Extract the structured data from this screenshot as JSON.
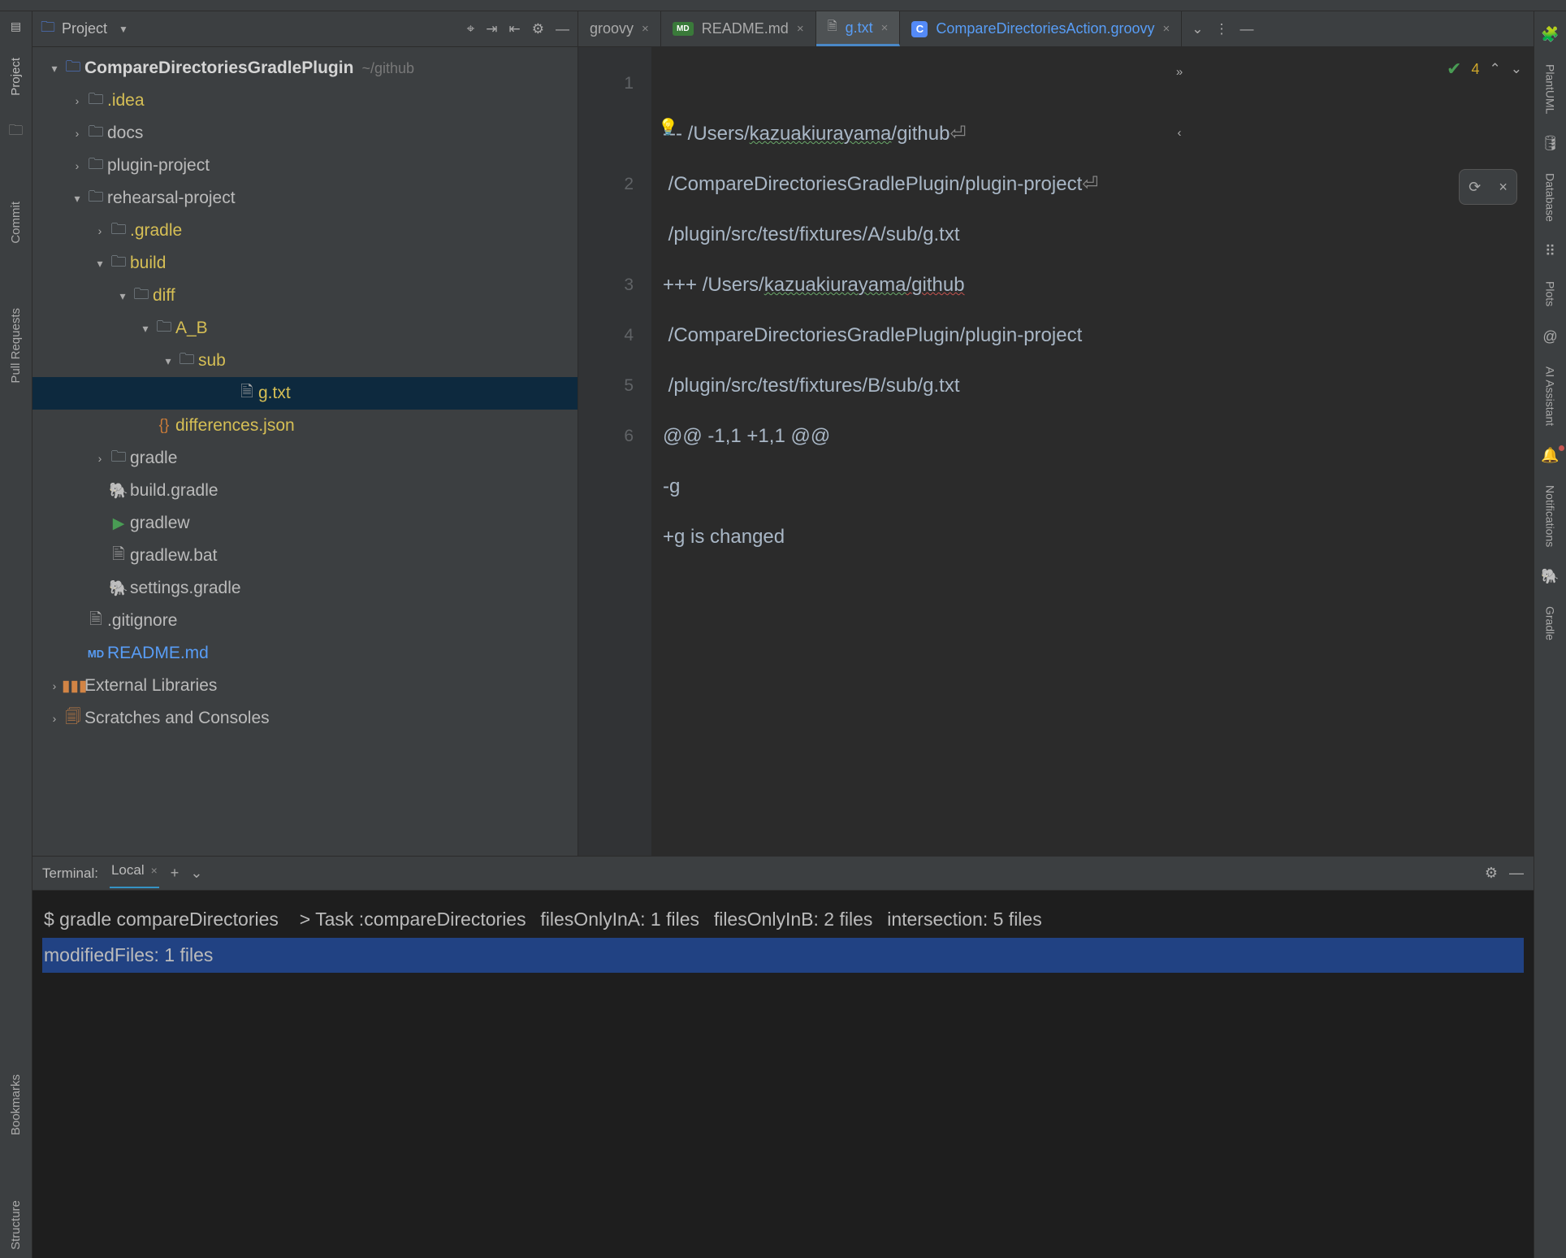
{
  "left_strip": {
    "items": [
      "Project",
      "Commit",
      "Pull Requests"
    ],
    "bottom": [
      "Bookmarks",
      "Structure"
    ]
  },
  "right_strip": {
    "items": [
      "PlantUML",
      "Database",
      "Plots",
      "AI Assistant",
      "Notifications",
      "Gradle"
    ]
  },
  "project_pane": {
    "title": "Project",
    "root": {
      "label": "CompareDirectoriesGradlePlugin",
      "path": "~/github"
    },
    "nodes": {
      "idea": ".idea",
      "docs": "docs",
      "plugin_project": "plugin-project",
      "rehearsal": "rehearsal-project",
      "gradle_hidden": ".gradle",
      "build": "build",
      "diff": "diff",
      "a_b": "A_B",
      "sub": "sub",
      "gtxt": "g.txt",
      "differences": "differences.json",
      "gradle_dir": "gradle",
      "build_gradle": "build.gradle",
      "gradlew": "gradlew",
      "gradlew_bat": "gradlew.bat",
      "settings_gradle": "settings.gradle",
      "gitignore": ".gitignore",
      "readme": "README.md",
      "ext_libs": "External Libraries",
      "scratches": "Scratches and Consoles"
    }
  },
  "tabs": {
    "t0": "groovy",
    "t1": "README.md",
    "t2": "g.txt",
    "t3": "CompareDirectoriesAction.groovy"
  },
  "hints": {
    "count": "4"
  },
  "editor": {
    "gutter": [
      "1",
      "2",
      "3",
      "4",
      "5",
      "6"
    ],
    "l1a": "--- /Users/",
    "l1b": "kazuakiurayama",
    "l1c": "/github",
    "l1d": " /CompareDirectoriesGradlePlugin/plugin-project",
    "l1e": " /plugin/src/test/fixtures/A/sub/g.txt",
    "l2a": "+++ /Users/",
    "l2b": "kazuakiurayama",
    "l2c": "/github",
    "l2d": " /CompareDirectoriesGradlePlugin/plugin-project",
    "l2e": " /plugin/src/test/fixtures/B/sub/g.txt",
    "l3": "@@ -1,1 +1,1 @@",
    "l4": "-g",
    "l5": "+g is changed"
  },
  "terminal": {
    "title": "Terminal:",
    "tab": "Local",
    "lines": [
      "$ gradle compareDirectories",
      "",
      "",
      "> Task :compareDirectories",
      "filesOnlyInA: 1 files",
      "filesOnlyInB: 2 files",
      "intersection: 5 files",
      "modifiedFiles: 1 files"
    ]
  }
}
